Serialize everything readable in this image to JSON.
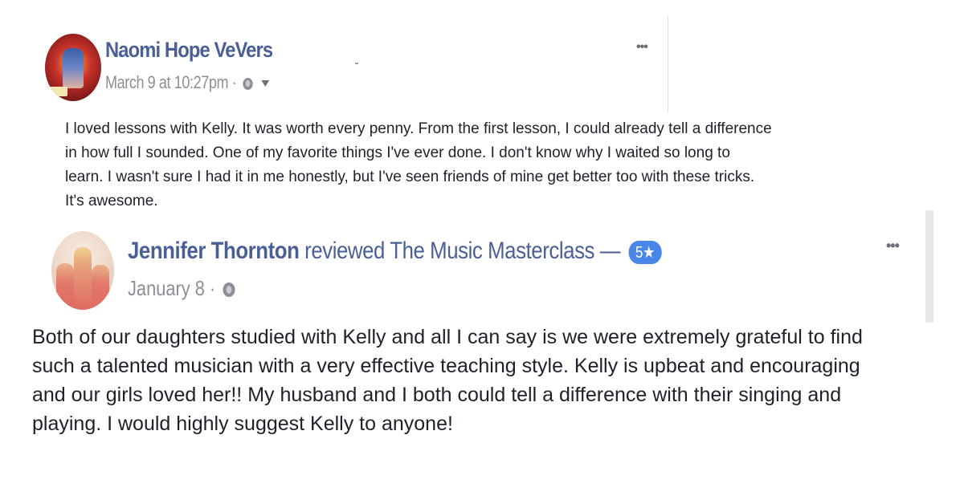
{
  "post1": {
    "author": "Naomi Hope VeVers",
    "timestamp": "March 9 at 10:27pm",
    "separator": "·",
    "privacy_icon": "globe-icon",
    "menu_icon": "caret-down-icon",
    "more_label": "•••",
    "body": "I loved lessons with Kelly.  It was worth every penny.  From the first lesson, I could already tell a difference in how full I sounded.  One of my favorite things I've ever done. I don't know why I waited so long to learn.   I wasn't sure I had it in me honestly, but I've seen friends of mine get better too with these tricks.  It's awesome."
  },
  "post2": {
    "author": "Jennifer Thornton",
    "action": "reviewed",
    "page": "The Music Masterclass",
    "dash": "—",
    "rating": "5★",
    "timestamp": "January 8",
    "separator": "·",
    "privacy_icon": "globe-icon",
    "more_label": "•••",
    "body": "Both of our daughters studied with Kelly and all I can say is we were extremely grateful to find such a talented musician with a very effective teaching style.  Kelly is upbeat and encouraging and our girls loved her!! My husband and I both could tell a difference with their singing and playing.  I would highly suggest Kelly to anyone!"
  },
  "colors": {
    "name_blue": "#4b5f97",
    "meta_gray": "#8b8f98",
    "text": "#1d2129",
    "badge_blue": "#4a86e8"
  }
}
